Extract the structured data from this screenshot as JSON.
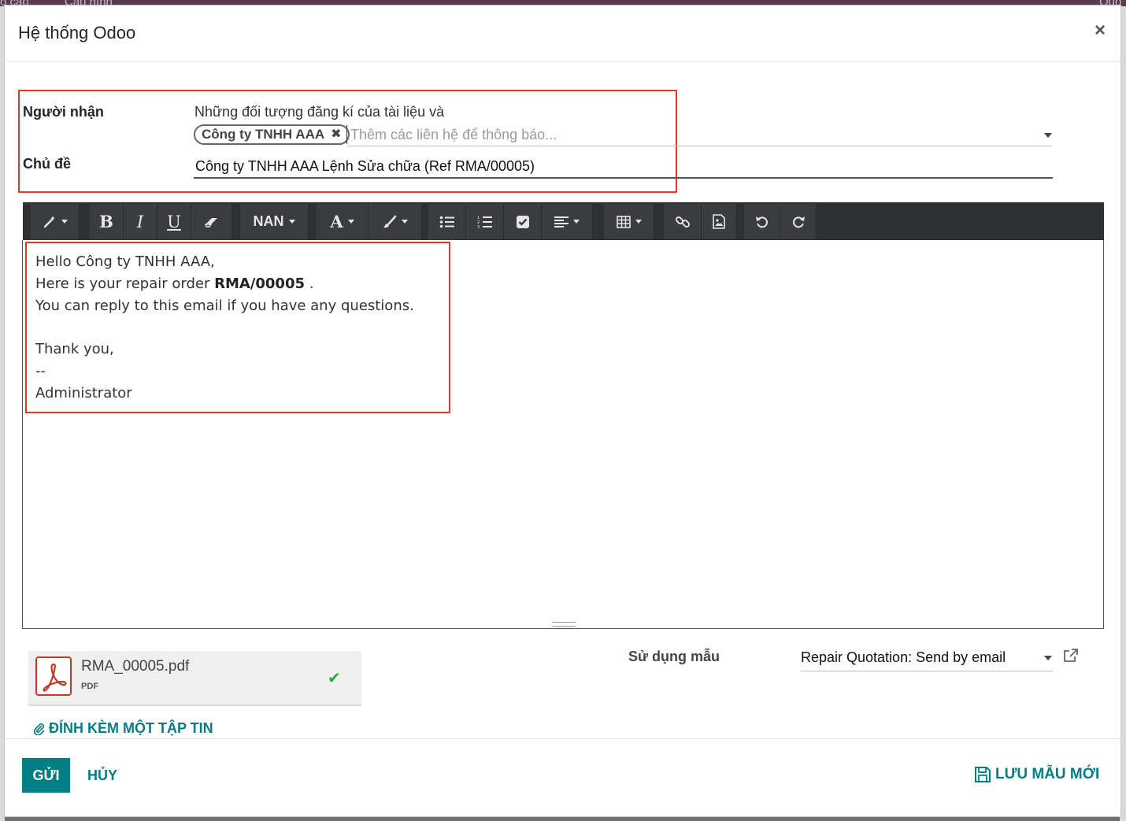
{
  "backdrop": {
    "ghost_left": "o cáo",
    "ghost_menu": "Cấu hình",
    "ghost_right": "Quo"
  },
  "dialog": {
    "title": "Hệ thống Odoo"
  },
  "form": {
    "recipients_label": "Người nhận",
    "recipients_text": "Những đối tượng đăng kí của tài liệu và",
    "recipient_tags": [
      "Công ty TNHH AAA"
    ],
    "recipients_placeholder": "Thêm các liên hệ để thông báo...",
    "subject_label": "Chủ đề",
    "subject_value": "Công ty TNHH AAA Lệnh Sửa chữa (Ref RMA/00005)"
  },
  "toolbar": {
    "font_size_label": "NAN",
    "bold": "B",
    "italic": "I",
    "underline": "U",
    "font_color": "A"
  },
  "editor": {
    "line1": "Hello Công ty TNHH AAA,",
    "line2_prefix": "Here is your repair order ",
    "line2_bold": "RMA/00005",
    "line2_suffix": " .",
    "line3": "You can reply to this email if you have any questions.",
    "line4": "Thank you,",
    "line5": "--",
    "line6": "Administrator"
  },
  "attachment": {
    "filename": "RMA_00005.pdf",
    "type": "PDF"
  },
  "attach_link_label": "ĐÍNH KÈM MỘT TẬP TIN",
  "template": {
    "label": "Sử dụng mẫu",
    "value": "Repair Quotation: Send by email"
  },
  "footer": {
    "send_label": "GỬI",
    "cancel_label": "HỦY",
    "save_template_label": "LƯU MẪU MỚI"
  },
  "colors": {
    "primary": "#017e84",
    "highlight": "#e03a2f",
    "toolbar_bg": "#2f3034",
    "success": "#28a745",
    "pdf_red": "#c0392b"
  }
}
